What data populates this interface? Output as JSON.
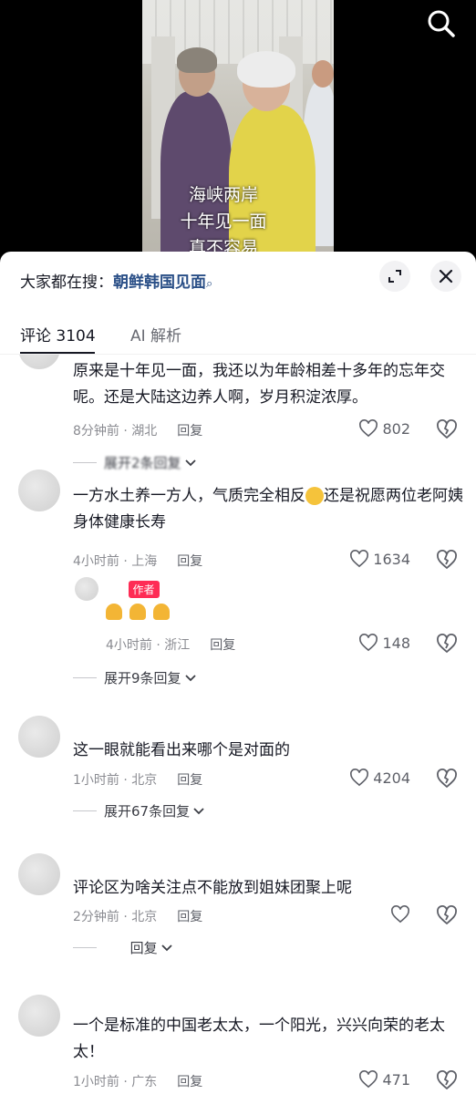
{
  "video": {
    "caption_lines": [
      "海峡两岸",
      "十年见一面",
      "真不容易"
    ],
    "search_icon": "search-icon"
  },
  "sheet": {
    "search_prefix": "大家都在搜：",
    "search_keyword": "朝鲜韩国见面",
    "tabs": [
      {
        "label": "评论 3104",
        "active": true
      },
      {
        "label": "AI 解析",
        "active": false
      }
    ]
  },
  "comments": [
    {
      "text": "原来是十年见一面，我还以为年龄相差十多年的忘年交呢。还是大陆这边养人啊，岁月积淀浓厚。",
      "time_loc": "8分钟前 · 湖北",
      "reply": "回复",
      "likes": "802",
      "expand": "展开2条回复"
    },
    {
      "text_before": "一方水土养一方人，气质完全相反",
      "text_after": "还是祝愿两位老阿姨身体健康长寿",
      "time_loc": "4小时前 · 上海",
      "reply": "回复",
      "likes": "1634"
    },
    {
      "author_badge": "作者",
      "time_loc": "4小时前 · 浙江",
      "reply": "回复",
      "likes": "148",
      "expand": "展开9条回复"
    },
    {
      "text": "这一眼就能看出来哪个是对面的",
      "time_loc": "1小时前 · 北京",
      "reply": "回复",
      "likes": "4204",
      "expand": "展开67条回复"
    },
    {
      "text": "评论区为啥关注点不能放到姐妹团聚上呢",
      "time_loc": "2分钟前 · 北京",
      "reply": "回复",
      "expand": "回复"
    },
    {
      "text": "一个是标准的中国老太太，一个阳光，兴兴向荣的老太太！",
      "time_loc": "1小时前 · 广东",
      "reply": "回复",
      "likes": "471"
    }
  ]
}
